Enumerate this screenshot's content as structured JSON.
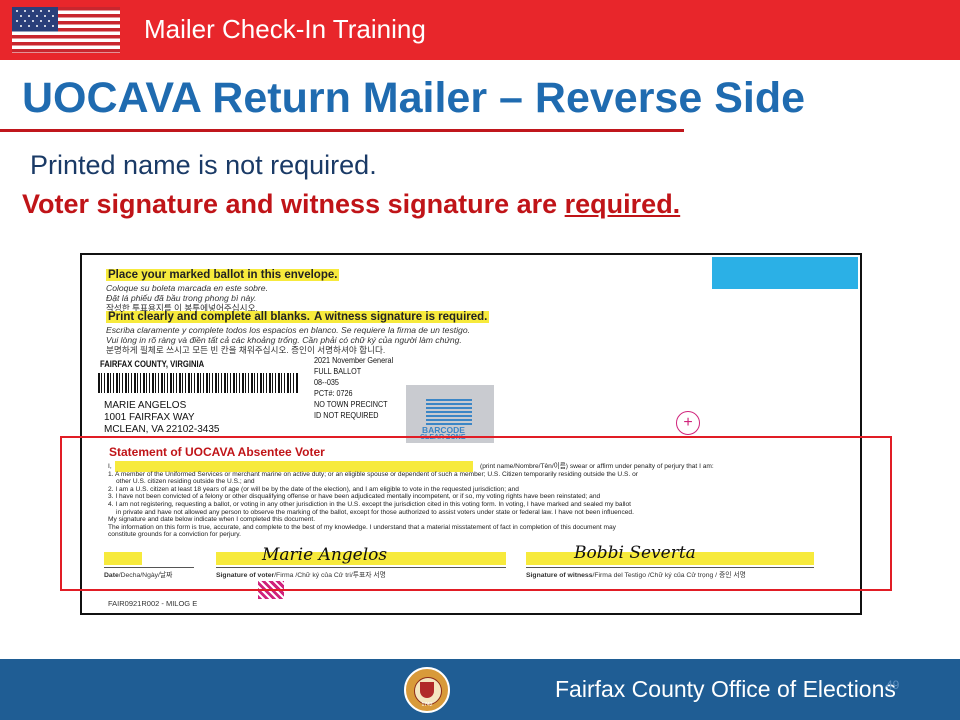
{
  "header": {
    "title": "Mailer Check-In Training",
    "flag_icon": "us-flag-icon"
  },
  "slide": {
    "title": "UOCAVA Return Mailer – Reverse Side",
    "line1": "Printed name is not required.",
    "line2_prefix": "Voter signature and witness signature are ",
    "line2_emphasis": "required."
  },
  "mailer": {
    "instr1_title": "Place your marked ballot in this envelope.",
    "instr1_es": "Coloque su boleta marcada en este sobre.",
    "instr1_vi": "Đặt lá phiếu đã bầu trong phong bì này.",
    "instr1_ko": "작성한 투표용지를 이 봉투에넣어주십시오.",
    "instr2_title_a": "Print clearly and complete all blanks.",
    "instr2_title_b": "A witness signature is required.",
    "instr2_es": "Escriba claramente y complete todos los espacios en blanco. Se requiere la firma de un testigo.",
    "instr2_vi": "Vui lòng in rõ ràng và điền tất cả các khoảng trống. Cần phải có chữ ký của người làm chứng.",
    "instr2_ko": "분명하게 필체로 쓰시고 모든 빈 칸을 채워주십시오. 증인이 서명하셔야 합니다.",
    "county": "FAIRFAX COUNTY, VIRGINIA",
    "address_lines": [
      "MARIE ANGELOS",
      "1001 FAIRFAX WAY",
      "MCLEAN, VA 22102-3435"
    ],
    "ballot_info": [
      "2021 November General",
      "FULL BALLOT",
      "08--035",
      "PCT#: 0726",
      "NO TOWN PRECINCT",
      "ID NOT REQUIRED"
    ],
    "barcode_zone_label1": "BARCODE",
    "barcode_zone_label2": "CLEAR ZONE",
    "statement_title": "Statement of UOCAVA Absentee Voter",
    "oath_name_suffix": "(print name/Nombre/Tên/이름) swear or affirm under penalty of perjury that I am:",
    "oath_lines": [
      "1. A member of the Uniformed Services or merchant marine on active duty; or an eligible spouse or dependent of such a member; U.S. Citizen temporarily residing outside the U.S. or",
      "other U.S. citizen residing outside the U.S.; and",
      "2. I am a U.S. citizen at least 18 years of age (or will be by the date of the election), and I am eligible to vote in the requested jurisdiction; and",
      "3. I have not been convicted of a felony or other disqualifying offense or have been adjudicated mentally incompetent, or if so, my voting rights have been reinstated; and",
      "4. I am not registering, requesting a ballot, or voting in any other jurisdiction in the U.S. except the jurisdiction cited in this voting form. In voting, I have marked and sealed my ballot",
      "in private and have not allowed any person to observe the marking of the ballot, except for those authorized to assist voters under state or federal law. I have not been influenced.",
      "My signature and date below indicate when I completed this document.",
      "The information on this form is true, accurate, and complete to the best of my knowledge. I understand that a material misstatement of fact in completion of this document may",
      "constitute grounds for a conviction for perjury."
    ],
    "date_label": "Date",
    "date_label_ml": "/Decha/Ngày/날짜",
    "voter_sig_label": "Signature of voter",
    "voter_sig_label_ml": "/Firma /Chữ ký của Cử tri/투표자 서명",
    "witness_sig_label": "Signature of witness",
    "witness_sig_label_ml": "/Firma del Testigo /Chữ ký của Cử trọng / 증인 서명",
    "voter_signature": "Marie Angelos",
    "witness_signature": "Bobbi Severta",
    "form_id": "FAIR0921R002 - MILOG E"
  },
  "footer": {
    "org": "Fairfax County Office of Elections",
    "seal_icon": "county-seal-icon",
    "seal_year": "1742",
    "slide_number": "49"
  },
  "colors": {
    "top_bar": "#e8262b",
    "title_blue": "#1f6bb0",
    "emphasis_red": "#c01418",
    "highlight_yellow": "#f7ea3c",
    "bottom_bar": "#1f5d94"
  }
}
